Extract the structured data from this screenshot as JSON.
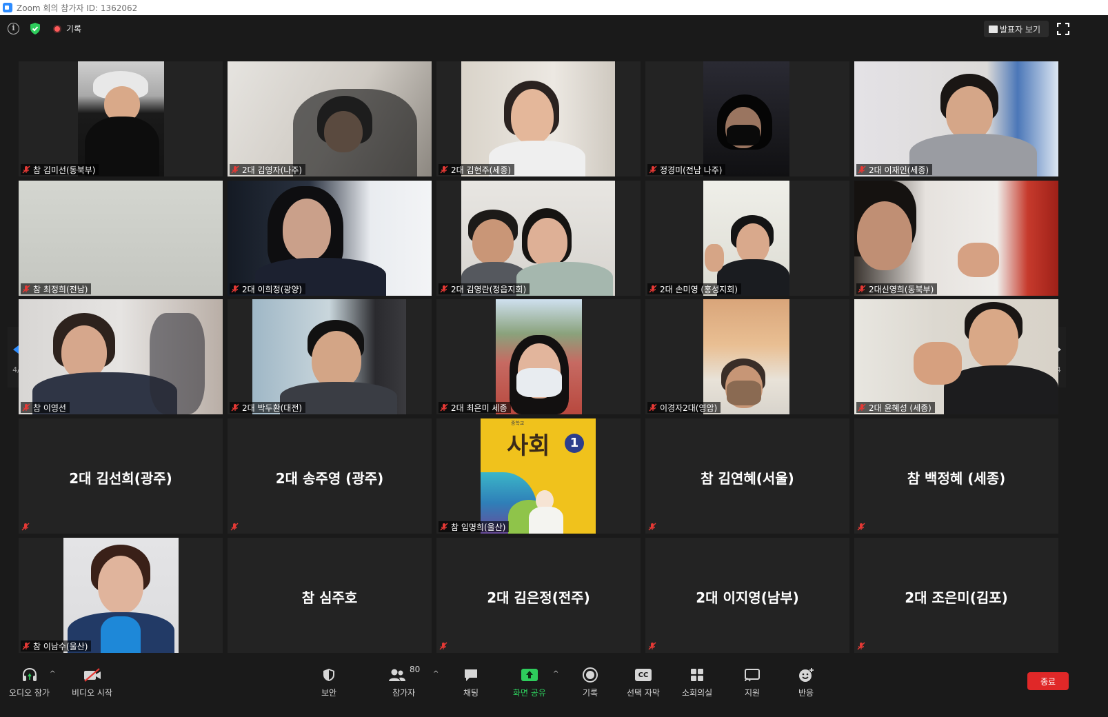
{
  "window": {
    "title": "Zoom 회의 참가자 ID: 1362062"
  },
  "topbar": {
    "record_label": "기록",
    "speaker_view_label": "발표자 보기"
  },
  "pager": {
    "left_page": "4/4",
    "right_page": "4/4"
  },
  "tiles": [
    {
      "name": "참 김미선(동북부)"
    },
    {
      "name": "2대 김영자(나주)"
    },
    {
      "name": "2대 김현주(세종)"
    },
    {
      "name": "정경미(전남 나주)"
    },
    {
      "name": "2대 이재인(세종)"
    },
    {
      "name": "참 최정희(전남)"
    },
    {
      "name": "2대 이희정(광양)"
    },
    {
      "name": "2대 김영란(정읍지회)"
    },
    {
      "name": "2대 손미영 (홍성지회)"
    },
    {
      "name": "2대신영희(동북부)"
    },
    {
      "name": "참 이영선"
    },
    {
      "name": "2대 박두환(대전)"
    },
    {
      "name": "2대 최은미 세종"
    },
    {
      "name": "이경자2대(영암)"
    },
    {
      "name": "2대 윤혜성 (세종)"
    },
    {
      "name": "2대 김선희(광주)"
    },
    {
      "name": "2대  송주영 (광주)"
    },
    {
      "name": "참 임명희(울산)",
      "book_small": "중학교",
      "book_title": "사회",
      "book_num": "1"
    },
    {
      "name": "참 김연혜(서울)"
    },
    {
      "name": "참 백정혜 (세종)"
    },
    {
      "name": "참 이남수(울산)"
    },
    {
      "name": "참 심주호"
    },
    {
      "name": "2대 김은정(전주)"
    },
    {
      "name": "2대 이지영(남부)"
    },
    {
      "name": "2대 조은미(김포)"
    }
  ],
  "toolbar": {
    "audio_label": "오디오 참가",
    "video_label": "비디오 시작",
    "security_label": "보안",
    "participants_label": "참가자",
    "participants_count": "80",
    "chat_label": "채팅",
    "share_label": "화면 공유",
    "record_label": "기록",
    "cc_label": "선택 자막",
    "cc_glyph": "CC",
    "breakout_label": "소회의실",
    "support_label": "지원",
    "reactions_label": "반응",
    "end_label": "종료"
  },
  "colors": {
    "accent": "#2d8cff",
    "end": "#e02828",
    "share": "#2ecc5c",
    "mute": "#e53935"
  }
}
